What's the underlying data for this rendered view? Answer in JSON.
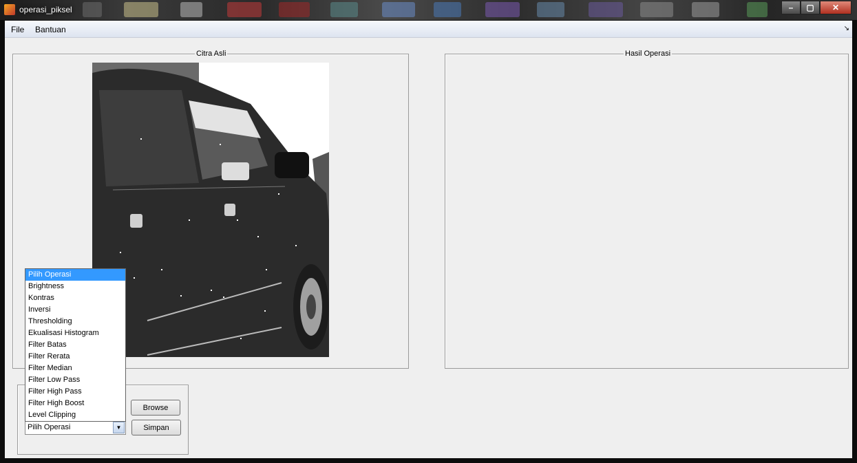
{
  "window": {
    "title": "operasi_piksel"
  },
  "menu": {
    "file": "File",
    "help": "Bantuan"
  },
  "panels": {
    "original": {
      "title": "Citra Asli"
    },
    "result": {
      "title": "Hasil Operasi"
    }
  },
  "controls": {
    "browse_label": "Browse",
    "save_label": "Simpan",
    "operation_selected": "Pilih Operasi",
    "operation_options": [
      "Pilih Operasi",
      "Brightness",
      "Kontras",
      "Inversi",
      "Thresholding",
      "Ekualisasi Histogram",
      "Filter Batas",
      "Filter Rerata",
      "Filter Median",
      "Filter Low Pass",
      "Filter High Pass",
      "Filter High Boost",
      "Level Clipping"
    ]
  }
}
